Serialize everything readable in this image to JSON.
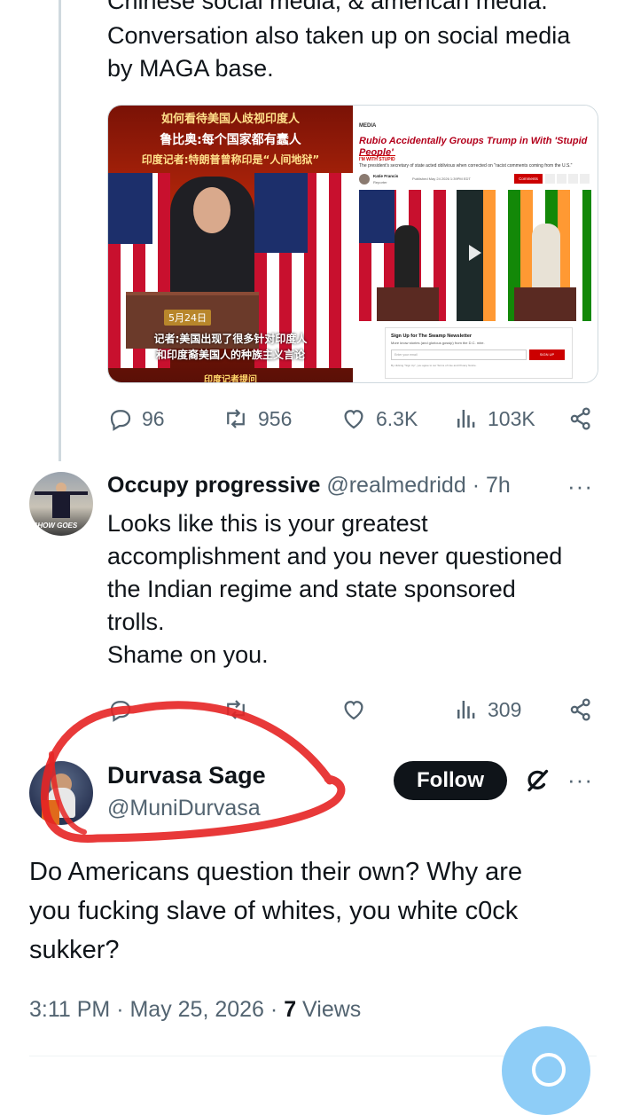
{
  "tweet1": {
    "text_line1": "Chinese social media, & american media.",
    "text_line2": "Conversation also taken up on social media",
    "text_line3": "by MAGA base.",
    "media_left": {
      "line1": "如何看待美国人歧视印度人",
      "line2": "鲁比奥:每个国家都有蠢人",
      "line3": "印度记者:特朗普曾称印是“人间地狱”",
      "date_badge": "5月24日",
      "caption1": "记者:美国出现了很多针对印度人",
      "caption2": "和印度裔美国人的种族主义言论",
      "caption3": "印度记者提问"
    },
    "media_right": {
      "brand": "MEDIA",
      "headline": "Rubio Accidentally Groups Trump in With 'Stupid People'",
      "tag": "I'M WITH STUPID",
      "subhead": "The president's secretary of state acted oblivious when corrected on \"racist comments coming from the U.S.\"",
      "author": "Katie Francis",
      "author_role": "Reporter",
      "published": "Published May 24 2026 1:39PM EDT",
      "comments_btn": "Comments",
      "newsletter_title": "Sign Up for The Swamp Newsletter",
      "newsletter_sub": "More know stories (and glorious gossip) from the D.C. mire.",
      "email_placeholder": "Enter your email",
      "signup_btn": "SIGN UP",
      "legal": "By clicking \"Sign Up\", you agree to our Terms of Use and Privacy Notice."
    },
    "stats": {
      "replies": "96",
      "reposts": "956",
      "likes": "6.3K",
      "views": "103K"
    }
  },
  "reply1": {
    "name": "Occupy progressive",
    "handle": "@realmedridd",
    "time": "· 7h",
    "avatar_caption": "SHOW GOES",
    "lines": [
      "Looks like this is your greatest",
      "accomplishment and you never questioned",
      "the Indian regime and state sponsored",
      "trolls.",
      "Shame on you."
    ],
    "stats": {
      "views": "309"
    }
  },
  "main_tweet": {
    "name": "Durvasa Sage",
    "handle": "@MuniDurvasa",
    "follow_label": "Follow",
    "lines": [
      "Do Americans question their own? Why are",
      "you fucking slave of whites, you white c0ck",
      "sukker?"
    ],
    "timestamp": "3:11 PM · May 25, 2026 ·",
    "views_count": "7",
    "views_label": "Views"
  },
  "colors": {
    "secondary_text": "#536471",
    "primary_text": "#0f1419",
    "annotation_red": "#e62424",
    "accent_blue": "#1d9bf0"
  },
  "icons": [
    "reply-icon",
    "repost-icon",
    "like-icon",
    "views-icon",
    "share-icon",
    "more-icon",
    "grok-icon",
    "compose-icon"
  ]
}
